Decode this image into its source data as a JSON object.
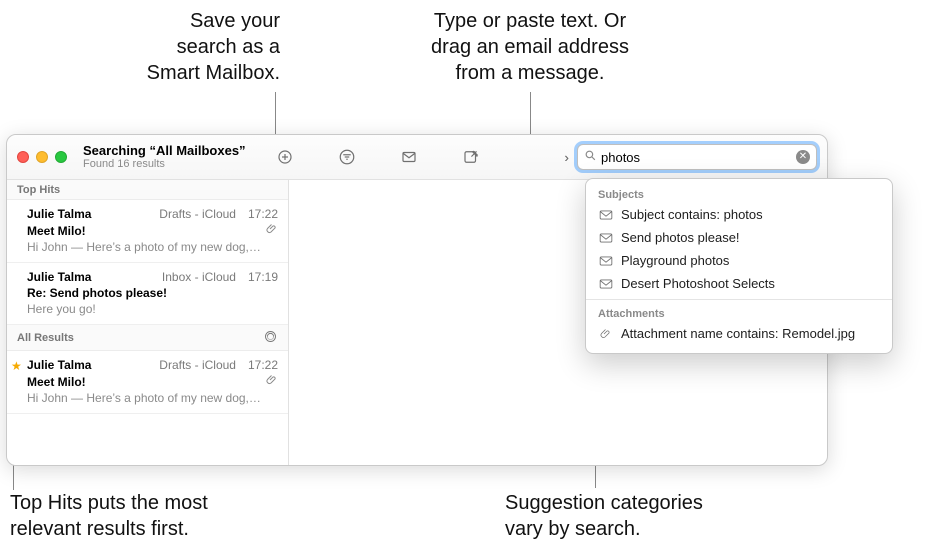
{
  "callouts": {
    "smart_mailbox": "Save your\nsearch as a\nSmart Mailbox.",
    "search_hint": "Type or paste text. Or\ndrag an email address\nfrom a message.",
    "top_hits": "Top Hits puts the most\nrelevant results first.",
    "suggestion_categories": "Suggestion categories\nvary by search."
  },
  "window": {
    "title": "Searching “All Mailboxes”",
    "subtitle": "Found 16 results"
  },
  "search": {
    "value": "photos"
  },
  "suggestions": {
    "subjects_heading": "Subjects",
    "items": [
      "Subject contains: photos",
      "Send photos please!",
      "Playground photos",
      "Desert Photoshoot Selects"
    ],
    "attachments_heading": "Attachments",
    "attachment_item": "Attachment name contains: Remodel.jpg"
  },
  "sections": {
    "top_hits": "Top Hits",
    "all_results": "All Results"
  },
  "messages": {
    "top": [
      {
        "sender": "Julie Talma",
        "location": "Drafts - iCloud",
        "time": "17:22",
        "subject": "Meet Milo!",
        "preview": "Hi John — Here’s a photo of my new dog,…",
        "has_attachment": true
      },
      {
        "sender": "Julie Talma",
        "location": "Inbox - iCloud",
        "time": "17:19",
        "subject": "Re: Send photos please!",
        "preview": "Here you go!",
        "has_attachment": false
      }
    ],
    "all": [
      {
        "sender": "Julie Talma",
        "location": "Drafts - iCloud",
        "time": "17:22",
        "subject": "Meet Milo!",
        "preview": "Hi John — Here’s a photo of my new dog,…",
        "has_attachment": true,
        "starred": true
      }
    ]
  }
}
